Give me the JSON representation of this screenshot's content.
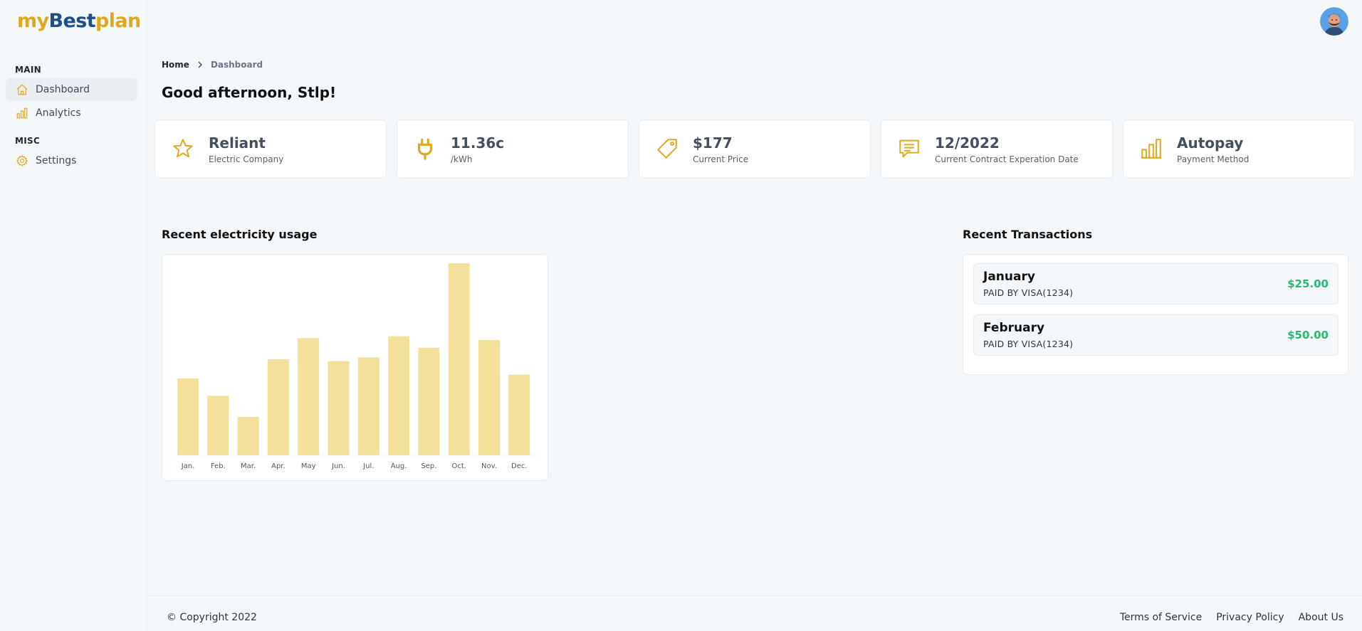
{
  "brand": {
    "part1": "my",
    "part2": "Best",
    "part3": "plan"
  },
  "sidebar": {
    "sections": [
      {
        "title": "MAIN"
      },
      {
        "title": "MISC"
      }
    ],
    "items": [
      {
        "label": "Dashboard",
        "icon": "home-icon"
      },
      {
        "label": "Analytics",
        "icon": "bar-chart-icon"
      },
      {
        "label": "Settings",
        "icon": "gear-icon"
      }
    ]
  },
  "breadcrumb": {
    "home": "Home",
    "current": "Dashboard"
  },
  "greeting": "Good afternoon, Stlp!",
  "stats": [
    {
      "value": "Reliant",
      "label": "Electric Company",
      "icon": "star-icon"
    },
    {
      "value": "11.36c",
      "label": "/kWh",
      "icon": "plug-icon"
    },
    {
      "value": "$177",
      "label": "Current Price",
      "icon": "tag-icon"
    },
    {
      "value": "12/2022",
      "label": "Current Contract Experation Date",
      "icon": "message-icon"
    },
    {
      "value": "Autopay",
      "label": "Payment Method",
      "icon": "bar-chart-icon"
    }
  ],
  "usage": {
    "title": "Recent electricity usage"
  },
  "chart_data": {
    "type": "bar",
    "categories": [
      "Jan.",
      "Feb.",
      "Mar.",
      "Apr.",
      "May",
      "Jun.",
      "Jul.",
      "Aug.",
      "Sep.",
      "Oct.",
      "Nov.",
      "Dec."
    ],
    "values": [
      40,
      31,
      20,
      50,
      61,
      49,
      51,
      62,
      56,
      100,
      60,
      42
    ],
    "color": "#f2e09b",
    "ylim": [
      0,
      100
    ],
    "grid": false
  },
  "transactions": {
    "title": "Recent Transactions",
    "items": [
      {
        "month": "January",
        "method": "PAID BY VISA(1234)",
        "amount": "$25.00"
      },
      {
        "month": "February",
        "method": "PAID BY VISA(1234)",
        "amount": "$50.00"
      }
    ]
  },
  "footer": {
    "copyright": "© Copyright 2022",
    "links": [
      "Terms of Service",
      "Privacy Policy",
      "About Us"
    ]
  },
  "colors": {
    "accent": "#e0a81d",
    "brand_blue": "#1d4f8c",
    "amount_green": "#2bb673"
  }
}
